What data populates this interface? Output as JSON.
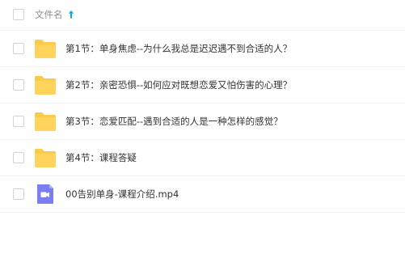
{
  "header": {
    "column_label": "文件名",
    "sort_icon": "arrow-up-icon",
    "sort_color": "#06a7ff"
  },
  "files": [
    {
      "name": "第1节：单身焦虑--为什么我总是迟迟遇不到合适的人？",
      "type": "folder",
      "icon": "folder-icon"
    },
    {
      "name": "第2节：亲密恐惧--如何应对既想恋爱又怕伤害的心理？",
      "type": "folder",
      "icon": "folder-icon"
    },
    {
      "name": "第3节：恋爱匹配--遇到合适的人是一种怎样的感觉？",
      "type": "folder",
      "icon": "folder-icon"
    },
    {
      "name": "第4节：课程答疑",
      "type": "folder",
      "icon": "folder-icon"
    },
    {
      "name": "00告别单身-课程介绍.mp4",
      "type": "video",
      "icon": "video-file-icon"
    }
  ],
  "colors": {
    "folder": "#ffc94a",
    "video": "#7b7ef2",
    "border": "#f1f2f5",
    "text": "#333333",
    "muted": "#8a8f99"
  }
}
